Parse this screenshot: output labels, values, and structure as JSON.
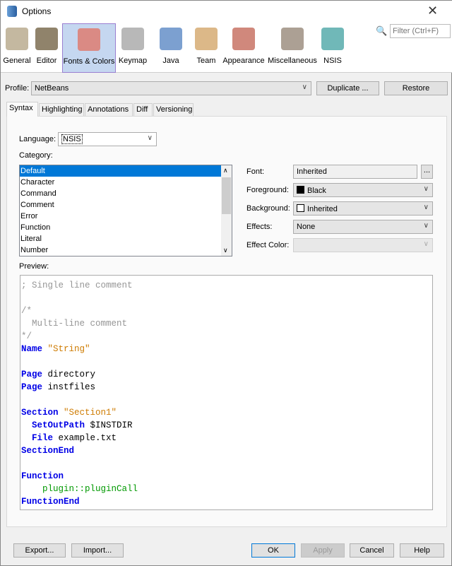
{
  "window": {
    "title": "Options",
    "close": "✕"
  },
  "categories": [
    {
      "label": "General",
      "icon": "general-icon"
    },
    {
      "label": "Editor",
      "icon": "editor-icon"
    },
    {
      "label": "Fonts & Colors",
      "icon": "fonts-colors-icon",
      "selected": true
    },
    {
      "label": "Keymap",
      "icon": "keymap-icon"
    },
    {
      "label": "Java",
      "icon": "java-icon"
    },
    {
      "label": "Team",
      "icon": "team-icon"
    },
    {
      "label": "Appearance",
      "icon": "appearance-icon"
    },
    {
      "label": "Miscellaneous",
      "icon": "miscellaneous-icon"
    },
    {
      "label": "NSIS",
      "icon": "nsis-icon"
    }
  ],
  "filter": {
    "placeholder": "Filter (Ctrl+F)"
  },
  "profile": {
    "label": "Profile:",
    "value": "NetBeans",
    "duplicate": "Duplicate ...",
    "restore": "Restore"
  },
  "tabs": [
    "Syntax",
    "Highlighting",
    "Annotations",
    "Diff",
    "Versioning"
  ],
  "syntax": {
    "language_label": "Language:",
    "language_value": "NSIS",
    "category_label": "Category:",
    "category_items": [
      "Default",
      "Character",
      "Command",
      "Comment",
      "Error",
      "Function",
      "Literal",
      "Number"
    ],
    "font_label": "Font:",
    "font_value": "Inherited",
    "font_browse": "...",
    "foreground_label": "Foreground:",
    "foreground_value": "Black",
    "background_label": "Background:",
    "background_value": "Inherited",
    "effects_label": "Effects:",
    "effects_value": "None",
    "effect_color_label": "Effect Color:",
    "preview_label": "Preview:"
  },
  "preview_lines": [
    [
      [
        "com",
        "; Single line comment"
      ]
    ],
    [],
    [
      [
        "com",
        "/*"
      ]
    ],
    [
      [
        "com",
        "  Multi-line comment"
      ]
    ],
    [
      [
        "com",
        "*/"
      ]
    ],
    [
      [
        "kw",
        "Name"
      ],
      [
        "txt",
        " "
      ],
      [
        "str",
        "\"String\""
      ]
    ],
    [],
    [
      [
        "kw",
        "Page"
      ],
      [
        "txt",
        " directory"
      ]
    ],
    [
      [
        "kw",
        "Page"
      ],
      [
        "txt",
        " instfiles"
      ]
    ],
    [],
    [
      [
        "kw",
        "Section"
      ],
      [
        "txt",
        " "
      ],
      [
        "str",
        "\"Section1\""
      ]
    ],
    [
      [
        "txt",
        "  "
      ],
      [
        "kw",
        "SetOutPath"
      ],
      [
        "txt",
        " $INSTDIR"
      ]
    ],
    [
      [
        "txt",
        "  "
      ],
      [
        "kw",
        "File"
      ],
      [
        "txt",
        " example.txt"
      ]
    ],
    [
      [
        "kw",
        "SectionEnd"
      ]
    ],
    [],
    [
      [
        "kw",
        "Function"
      ]
    ],
    [
      [
        "plg",
        "    plugin::pluginCall"
      ]
    ],
    [
      [
        "kw",
        "FunctionEnd"
      ]
    ]
  ],
  "footer": {
    "export": "Export...",
    "import": "Import...",
    "ok": "OK",
    "apply": "Apply",
    "cancel": "Cancel",
    "help": "Help"
  }
}
